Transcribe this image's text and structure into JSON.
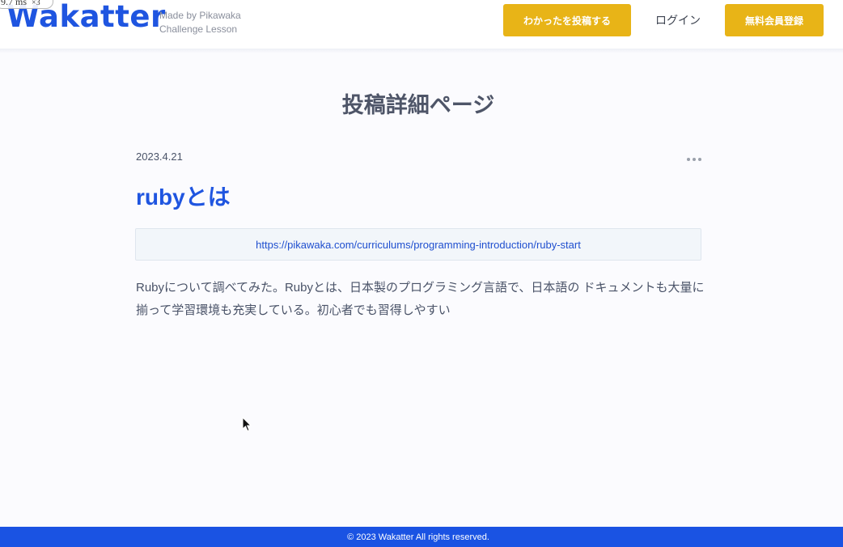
{
  "header": {
    "logo": "Wakatter",
    "tagline_line1": "Made by Pikawaka",
    "tagline_line2": "Challenge Lesson",
    "post_button": "わかったを投稿する",
    "login_link": "ログイン",
    "register_button": "無料会員登録",
    "dev_badge": "9.7 ms",
    "dev_badge_mult": "×3"
  },
  "main": {
    "page_title": "投稿詳細ページ",
    "post": {
      "date": "2023.4.21",
      "title": "rubyとは",
      "url": "https://pikawaka.com/curriculums/programming-introduction/ruby-start",
      "body": "Rubyについて調べてみた。Rubyとは、日本製のプログラミング言語で、日本語の ドキュメントも大量に揃って学習環境も充実している。初心者でも習得しやすい"
    }
  },
  "footer": {
    "copyright": "© 2023 Wakatter All rights reserved."
  },
  "colors": {
    "brand_blue": "#1f55e0",
    "accent_yellow": "#e8b417",
    "footer_blue": "#1a53e3",
    "background": "#fbfbfe"
  },
  "icons": {
    "more": "more-horizontal-icon",
    "cursor": "mouse-cursor-icon"
  }
}
